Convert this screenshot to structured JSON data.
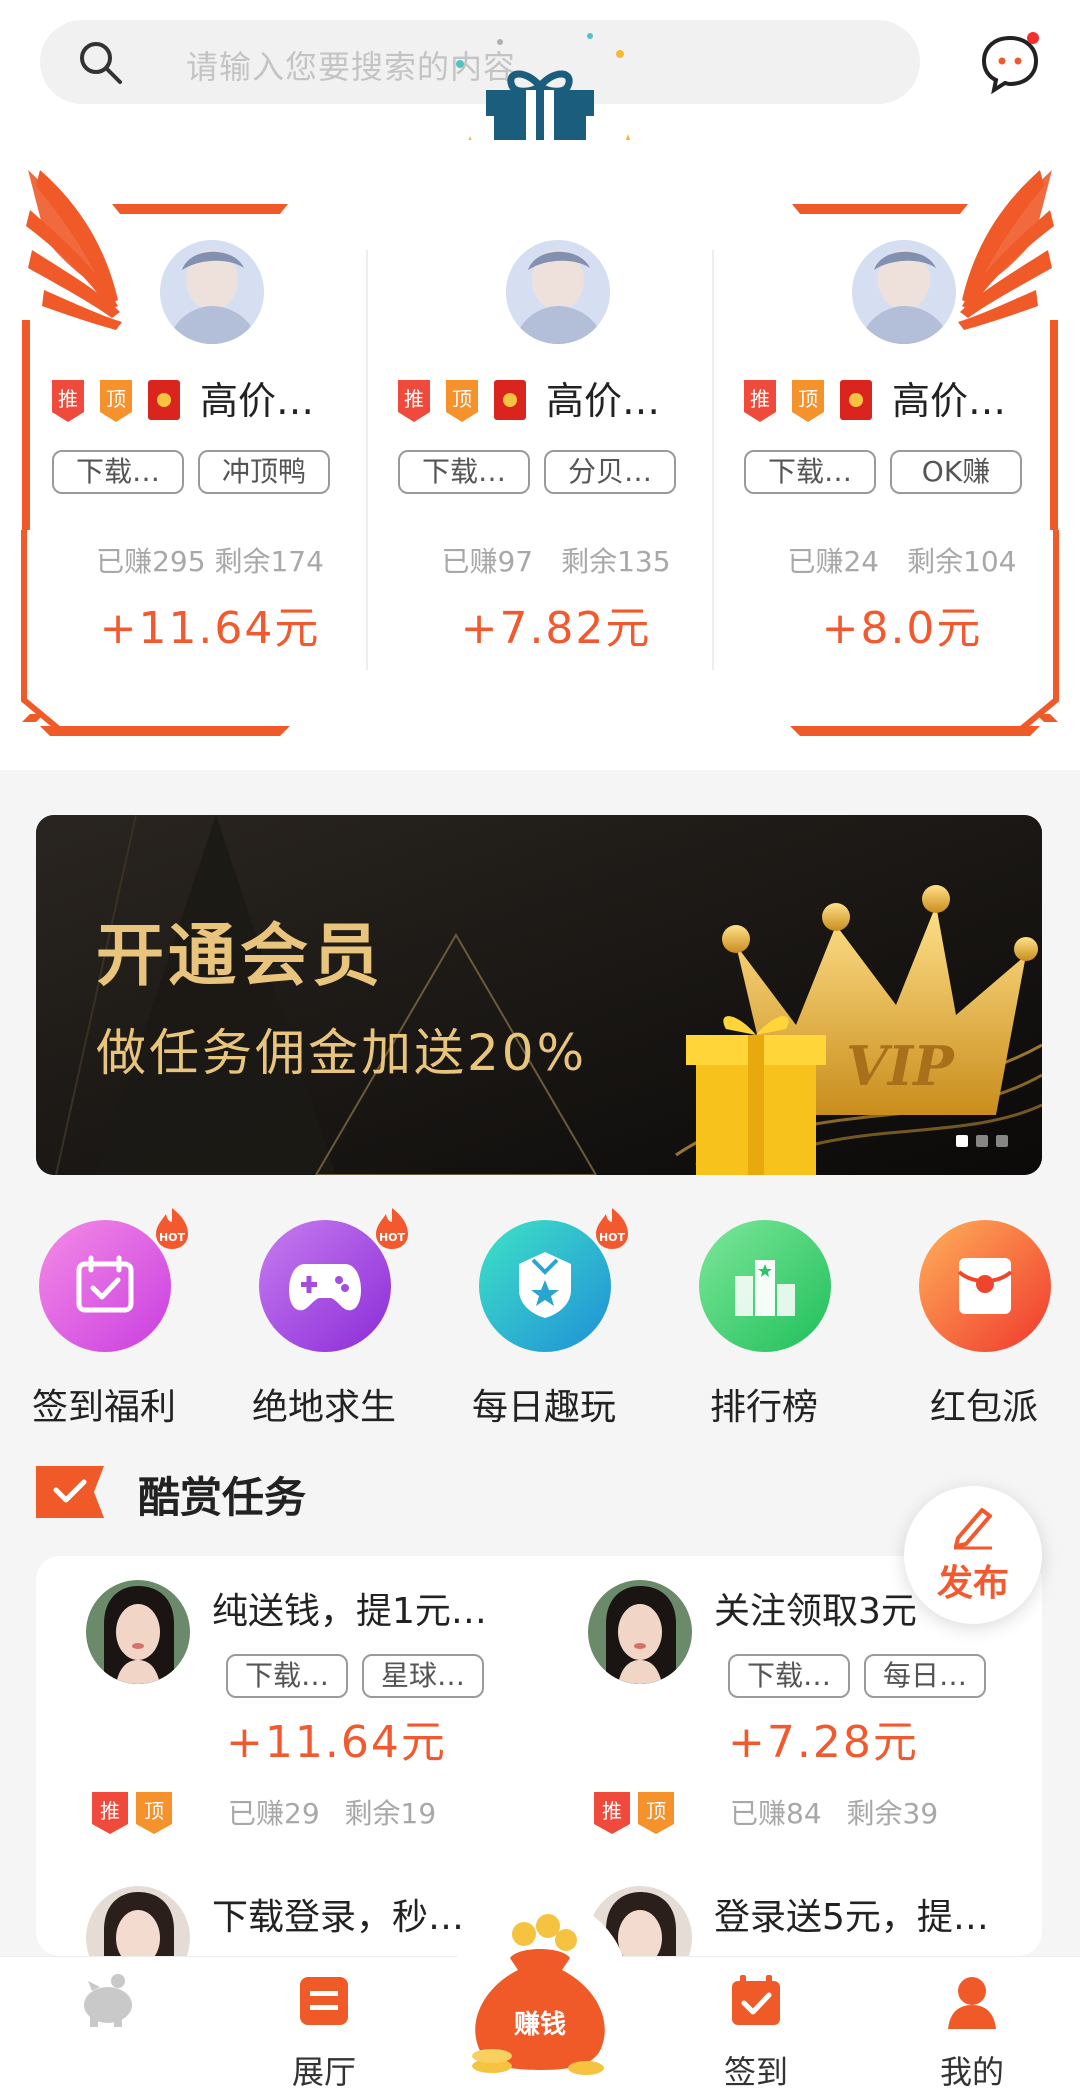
{
  "search": {
    "placeholder": "请输入您要搜索的内容"
  },
  "top_tasks": [
    {
      "title": "高价…",
      "tags": [
        "下载…",
        "冲顶鸭"
      ],
      "stats": "已赚295 剩余174",
      "reward": "+11.64元",
      "badges": [
        "推",
        "顶"
      ]
    },
    {
      "title": "高价…",
      "tags": [
        "下载…",
        "分贝…"
      ],
      "stats": "已赚97　剩余135",
      "reward": "+7.82元",
      "badges": [
        "推",
        "顶"
      ]
    },
    {
      "title": "高价…",
      "tags": [
        "下载…",
        "OK赚"
      ],
      "stats": "已赚24　剩余104",
      "reward": "+8.0元",
      "badges": [
        "推",
        "顶"
      ]
    }
  ],
  "banner": {
    "line1": "开通会员",
    "line2": "做任务佣金加送20%",
    "badge": "VIP",
    "slides": 3,
    "active_slide": 1
  },
  "quick": [
    {
      "label": "签到福利",
      "hot": true,
      "hot_text": "HOT"
    },
    {
      "label": "绝地求生",
      "hot": true,
      "hot_text": "HOT"
    },
    {
      "label": "每日趣玩",
      "hot": true,
      "hot_text": "HOT"
    },
    {
      "label": "排行榜",
      "hot": false
    },
    {
      "label": "红包派",
      "hot": false
    }
  ],
  "section": {
    "title": "酷赏任务"
  },
  "publish": {
    "label": "发布"
  },
  "cards": [
    {
      "title": "纯送钱，提1元…",
      "tags": [
        "下载…",
        "星球…"
      ],
      "reward": "+11.64元",
      "badges": [
        "推",
        "顶"
      ],
      "stats": "已赚29 剩余19"
    },
    {
      "title": "关注领取3元",
      "tags": [
        "下载…",
        "每日…"
      ],
      "reward": "+7.28元",
      "badges": [
        "推",
        "顶"
      ],
      "stats": "已赚84 剩余39"
    },
    {
      "title": "下载登录，秒…",
      "tags": [],
      "reward": "",
      "badges": [],
      "stats": ""
    },
    {
      "title": "登录送5元，提…",
      "tags": [],
      "reward": "",
      "badges": [],
      "stats": ""
    }
  ],
  "nav": [
    {
      "label": "",
      "icon": "piggy-bank-icon",
      "active": false
    },
    {
      "label": "展厅",
      "icon": "hall-icon",
      "active": true
    },
    {
      "label": "赚钱",
      "icon": "money-bag-icon",
      "active": false
    },
    {
      "label": "签到",
      "icon": "calendar-check-icon",
      "active": false
    },
    {
      "label": "我的",
      "icon": "user-icon",
      "active": false
    }
  ],
  "colors": {
    "accent": "#f2592e",
    "gold": "#e8c47d",
    "tag_border": "#9a9a9a",
    "muted": "#a8a8a8"
  }
}
